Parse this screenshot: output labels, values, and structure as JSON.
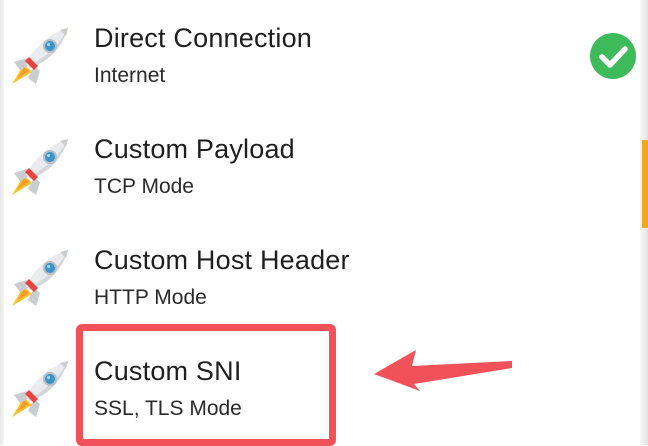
{
  "options": [
    {
      "title": "Direct Connection",
      "subtitle": "Internet",
      "icon": "rocket-icon",
      "selected": true
    },
    {
      "title": "Custom Payload",
      "subtitle": "TCP Mode",
      "icon": "rocket-icon",
      "selected": false
    },
    {
      "title": "Custom Host Header",
      "subtitle": "HTTP Mode",
      "icon": "rocket-icon",
      "selected": false
    },
    {
      "title": "Custom SNI",
      "subtitle": "SSL, TLS Mode",
      "icon": "rocket-icon",
      "selected": false
    }
  ],
  "selected_icon": "check-circle-icon",
  "annotation": {
    "highlighted_option": "Custom SNI",
    "color": "#f1525a"
  },
  "colors": {
    "check": "#3dba5a",
    "text": "#1f1f1f",
    "rocket_body": "#e9ebee",
    "rocket_fin": "#e8433f",
    "rocket_window": "#3a94c6",
    "rocket_flame": "#f7c631"
  }
}
